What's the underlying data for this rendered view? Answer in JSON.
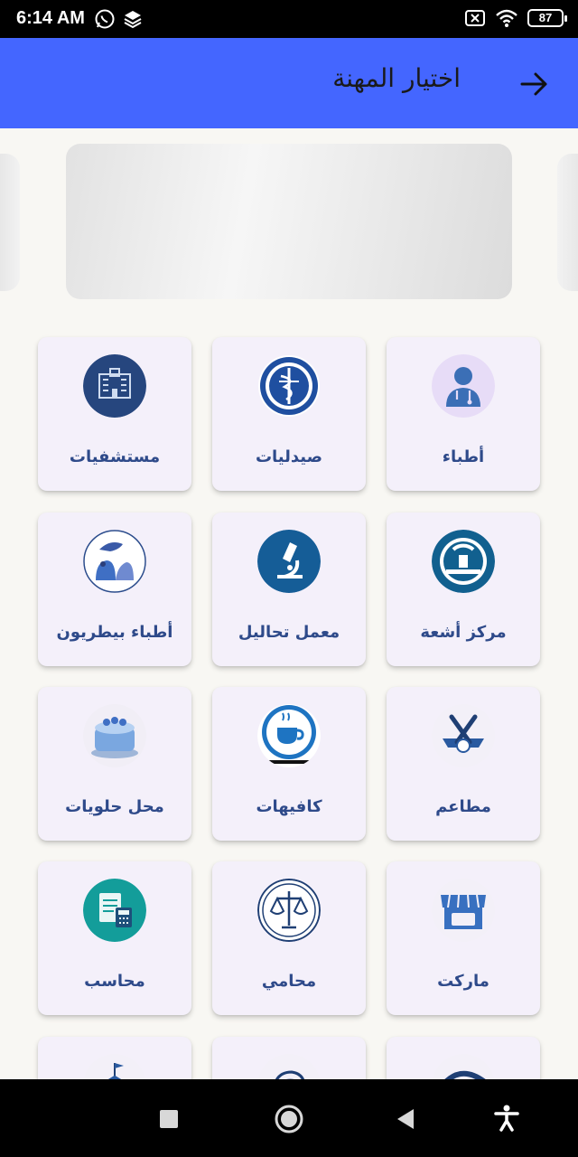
{
  "status_bar": {
    "time": "6:14 AM",
    "battery": "87"
  },
  "app_bar": {
    "title": "اختيار المهنة"
  },
  "categories": [
    {
      "label": "أطباء",
      "icon": "doctor-icon"
    },
    {
      "label": "صيدليات",
      "icon": "pharmacy-icon"
    },
    {
      "label": "مستشفيات",
      "icon": "hospital-icon"
    },
    {
      "label": "مركز أشعة",
      "icon": "radiology-icon"
    },
    {
      "label": "معمل تحاليل",
      "icon": "microscope-icon"
    },
    {
      "label": "أطباء بيطريون",
      "icon": "veterinary-icon"
    },
    {
      "label": "مطاعم",
      "icon": "restaurant-icon"
    },
    {
      "label": "كافيهات",
      "icon": "coffee-cup-icon"
    },
    {
      "label": "محل حلويات",
      "icon": "cake-icon"
    },
    {
      "label": "ماركت",
      "icon": "market-store-icon"
    },
    {
      "label": "محامي",
      "icon": "scales-of-justice-icon"
    },
    {
      "label": "محاسب",
      "icon": "accountant-calculator-icon"
    },
    {
      "label": "",
      "icon": "wave-icon"
    },
    {
      "label": "",
      "icon": "barber-icon"
    },
    {
      "label": "",
      "icon": "school-icon"
    }
  ]
}
